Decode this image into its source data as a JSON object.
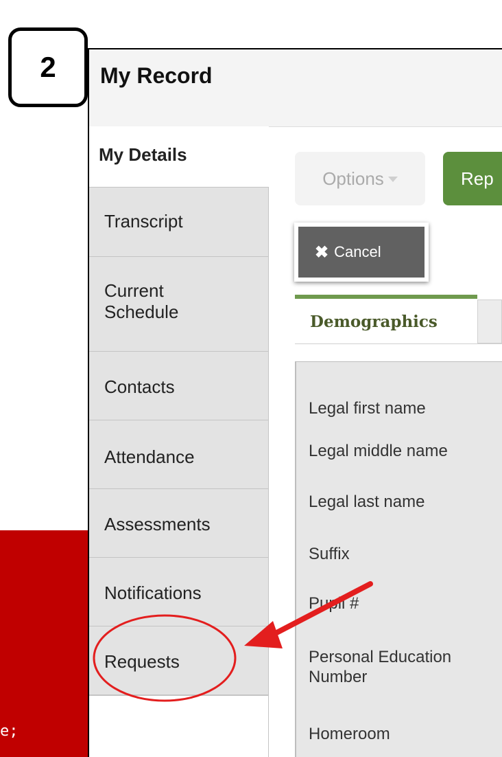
{
  "step": {
    "number": "2"
  },
  "red_panel": {
    "text": "e;"
  },
  "header": {
    "title": "My Record"
  },
  "sidebar": {
    "items": [
      {
        "label": "My Details",
        "active": true
      },
      {
        "label": "Transcript"
      },
      {
        "label": "Current Schedule"
      },
      {
        "label": "Contacts"
      },
      {
        "label": "Attendance"
      },
      {
        "label": "Assessments"
      },
      {
        "label": "Notifications"
      },
      {
        "label": "Requests"
      }
    ]
  },
  "toolbar": {
    "options_label": "Options",
    "report_label": "Rep",
    "cancel_label": "Cancel"
  },
  "tabs": {
    "active_label": "Demographics"
  },
  "form": {
    "fields": [
      "Legal first name",
      "Legal middle name",
      "Legal last name",
      "Suffix",
      "Pupil #",
      "Personal Education Number",
      "Homeroom"
    ]
  },
  "colors": {
    "accent_green": "#5c8f3d",
    "annotation_red": "#e31e1e",
    "panel_red": "#c00000"
  }
}
